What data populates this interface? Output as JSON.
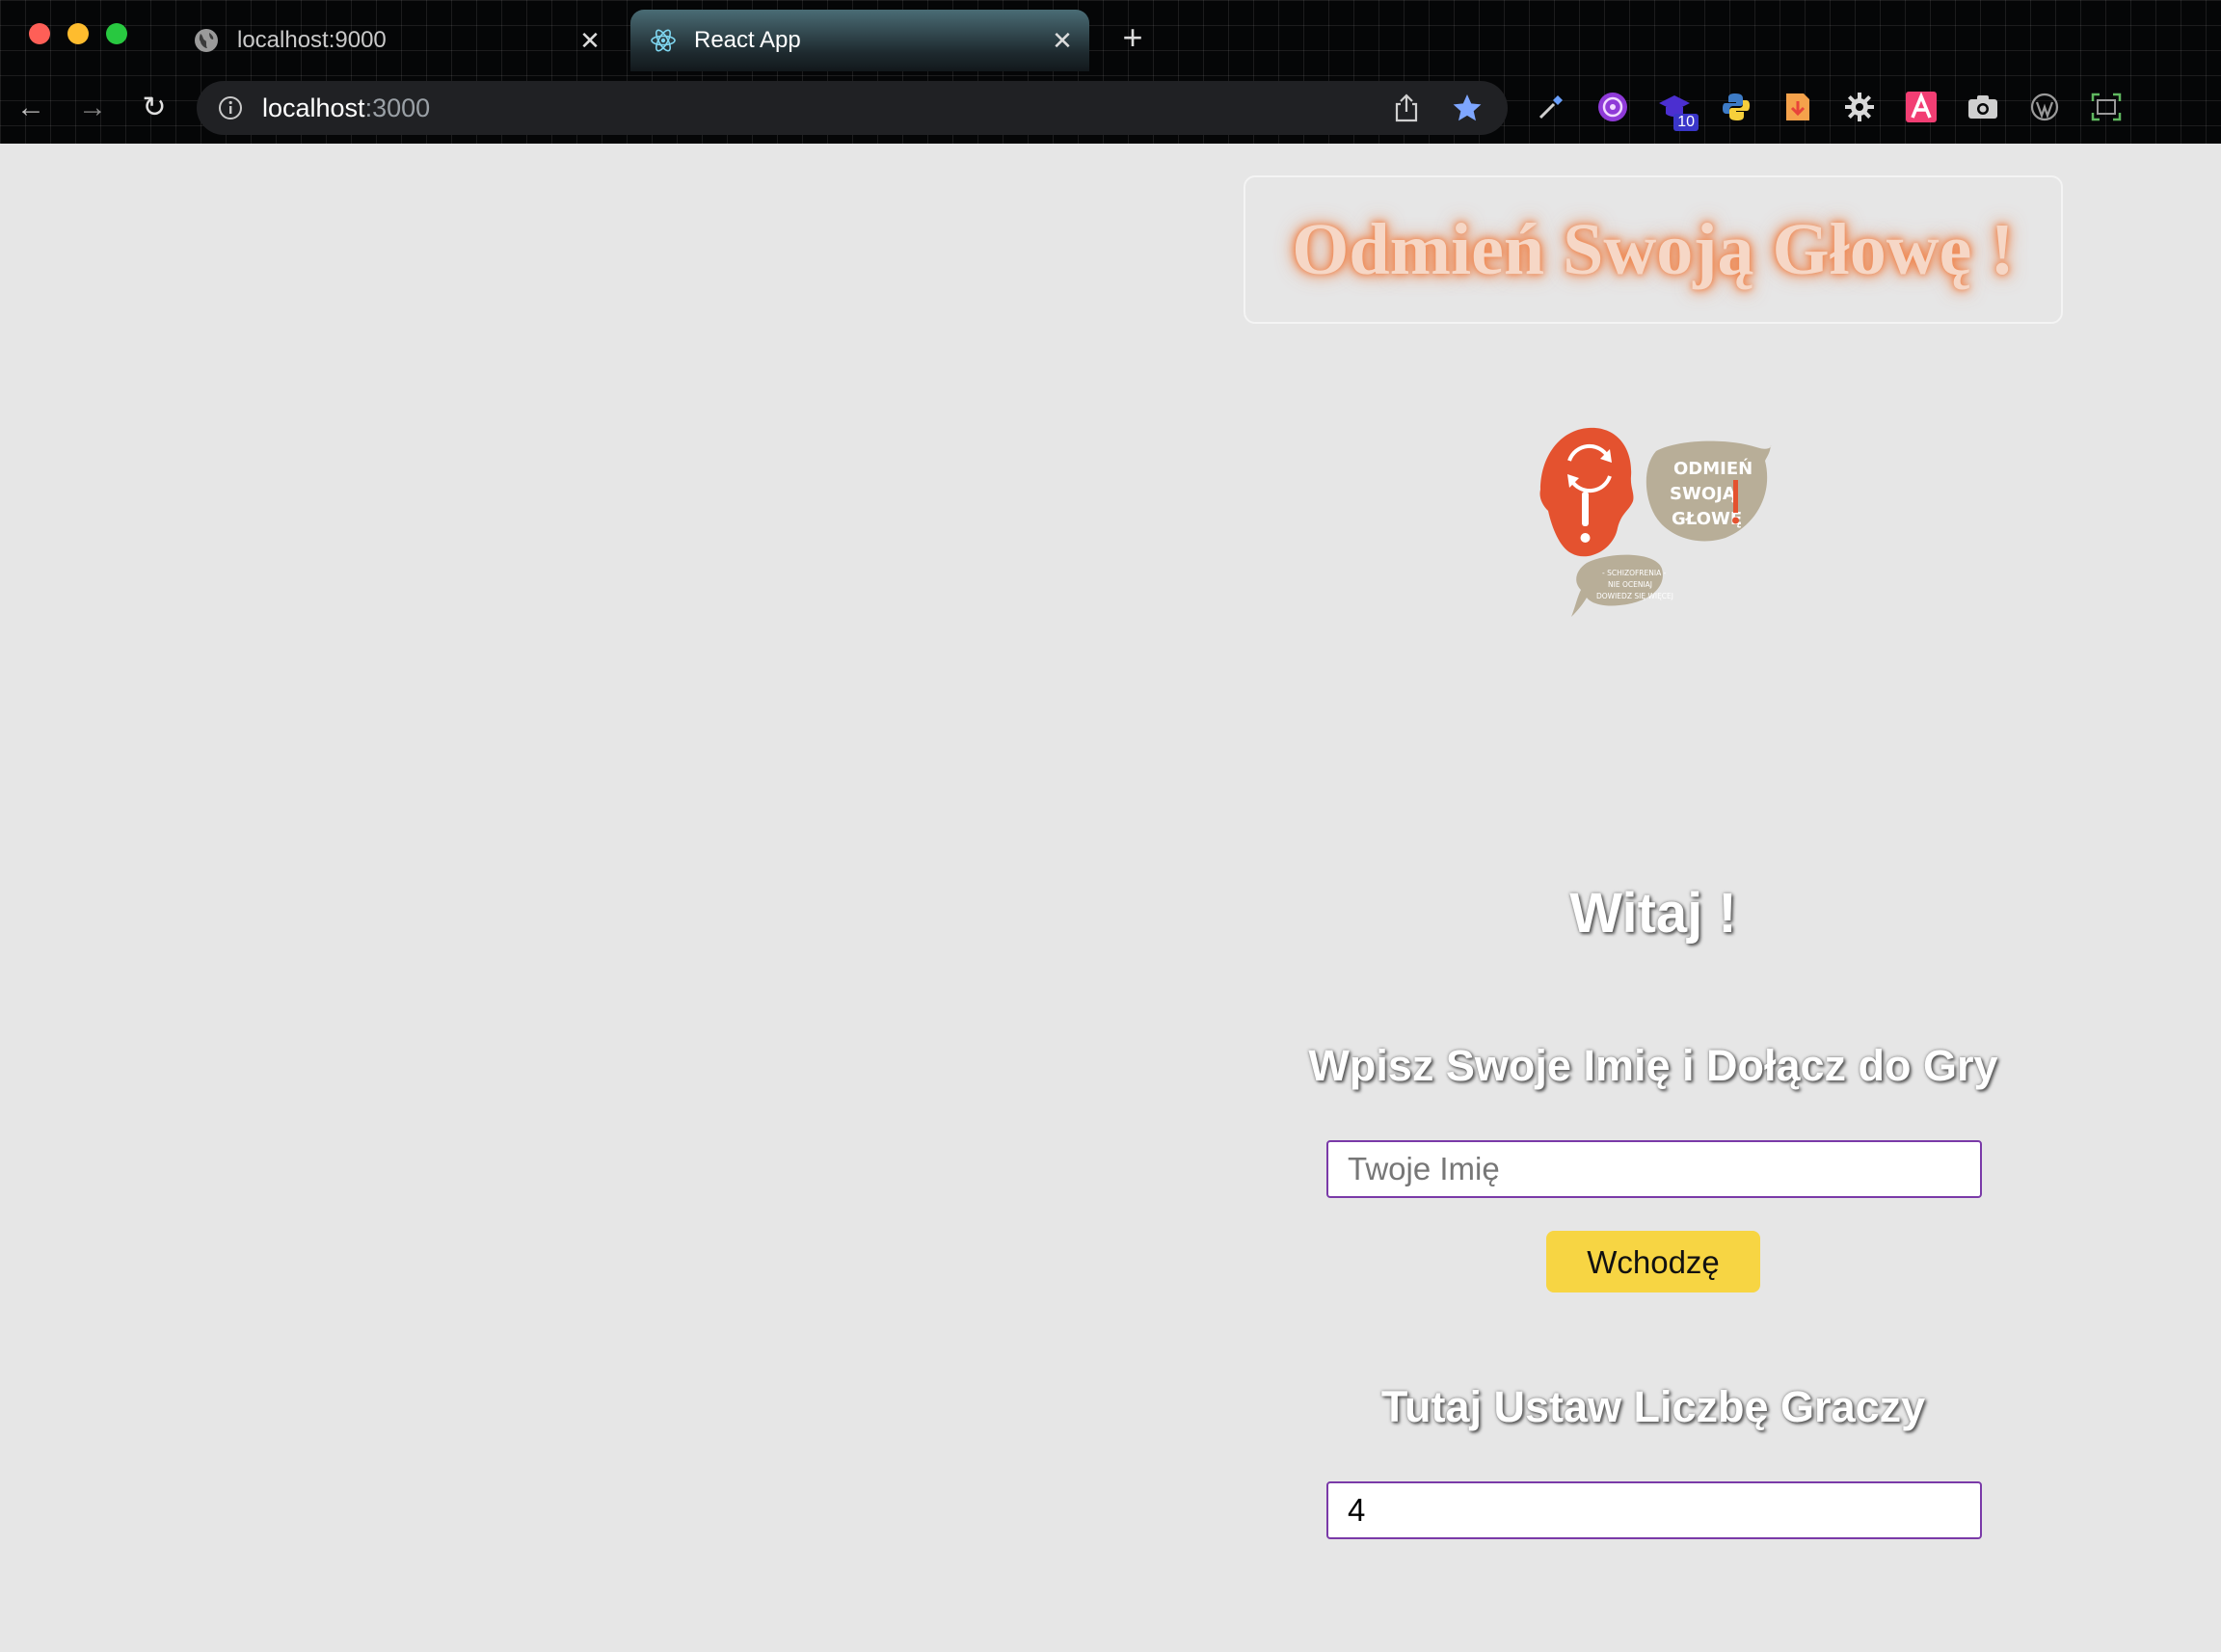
{
  "browser": {
    "tabs": [
      {
        "title": "localhost:9000",
        "icon": "globe-icon"
      },
      {
        "title": "React App",
        "icon": "react-icon",
        "active": true
      }
    ],
    "url_host": "localhost",
    "url_port": ":3000",
    "extensions": [
      "eyedropper-icon",
      "purple-circle-icon",
      "graduation-cap-icon",
      "python-icon",
      "download-icon",
      "gear-icon",
      "letter-a-icon",
      "camera-icon",
      "wordpress-icon",
      "screenshot-icon"
    ],
    "extension_badge": "10"
  },
  "page": {
    "title": "Odmień Swoją Głowę !",
    "logo": {
      "bubble_lines": [
        "ODMIEŃ",
        "SWOJĄ",
        "GŁOWĘ"
      ],
      "small_bubble_lines": [
        "- SCHIZOFRENIA -",
        "NIE OCENIAJ",
        "DOWIEDZ SIĘ WIĘCEJ"
      ]
    },
    "welcome": "Witaj !",
    "name_prompt": "Wpisz Swoje Imię i Dołącz do Gry",
    "name_placeholder": "Twoje Imię",
    "name_value": "",
    "enter_button": "Wchodzę",
    "players_prompt": "Tutaj Ustaw Liczbę Graczy",
    "players_value": "4"
  },
  "colors": {
    "page_background": "#e6e6e6",
    "title_glow": "#ef7a3c",
    "button_yellow": "#f7d543",
    "input_border": "#7a3aa8",
    "logo_head": "#e4522f",
    "logo_bubble": "#b8ae98"
  }
}
